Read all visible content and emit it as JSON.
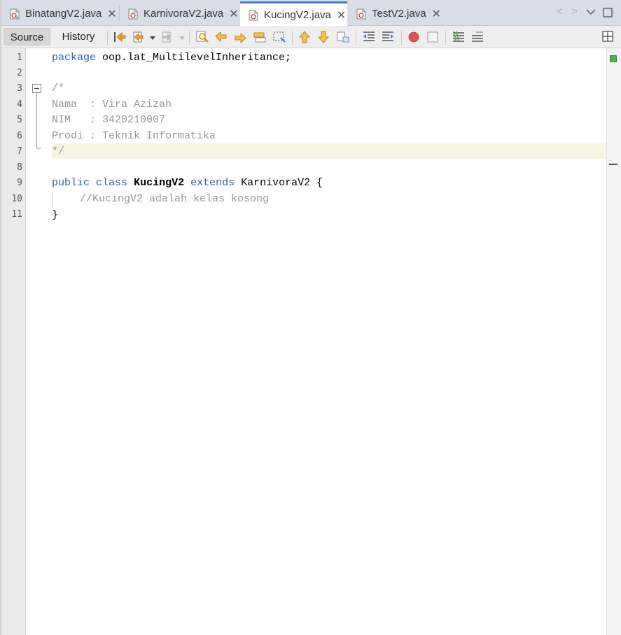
{
  "tabs": [
    {
      "label": "BinatangV2.java",
      "active": false
    },
    {
      "label": "KarnivoraV2.java",
      "active": false
    },
    {
      "label": "KucingV2.java",
      "active": true
    },
    {
      "label": "TestV2.java",
      "active": false
    }
  ],
  "toolbar": {
    "source_label": "Source",
    "history_label": "History"
  },
  "editor": {
    "line_numbers": [
      "1",
      "2",
      "3",
      "4",
      "5",
      "6",
      "7",
      "8",
      "9",
      "10",
      "11"
    ],
    "lines": {
      "l1_kw": "package",
      "l1_rest": " oop.lat_MultilevelInheritance;",
      "l3": "/*",
      "l4": "Nama  : Vira Azizah",
      "l5": "NIM   : 3420210007",
      "l6": "Prodi : Teknik Informatika",
      "l7": "*/",
      "l9_kw1": "public",
      "l9_kw2": "class",
      "l9_name": "KucingV2",
      "l9_kw3": "extends",
      "l9_parent": "KarnivoraV2",
      "l9_brace": "{",
      "l10": "//KucingV2 adalah kelas kosong",
      "l11": "}"
    }
  },
  "colors": {
    "keyword": "#2f5fb3",
    "comment": "#969696",
    "active_tab_accent": "#3d7fcf",
    "current_line": "#f8f4e2",
    "breakpoint": "#e05252"
  }
}
